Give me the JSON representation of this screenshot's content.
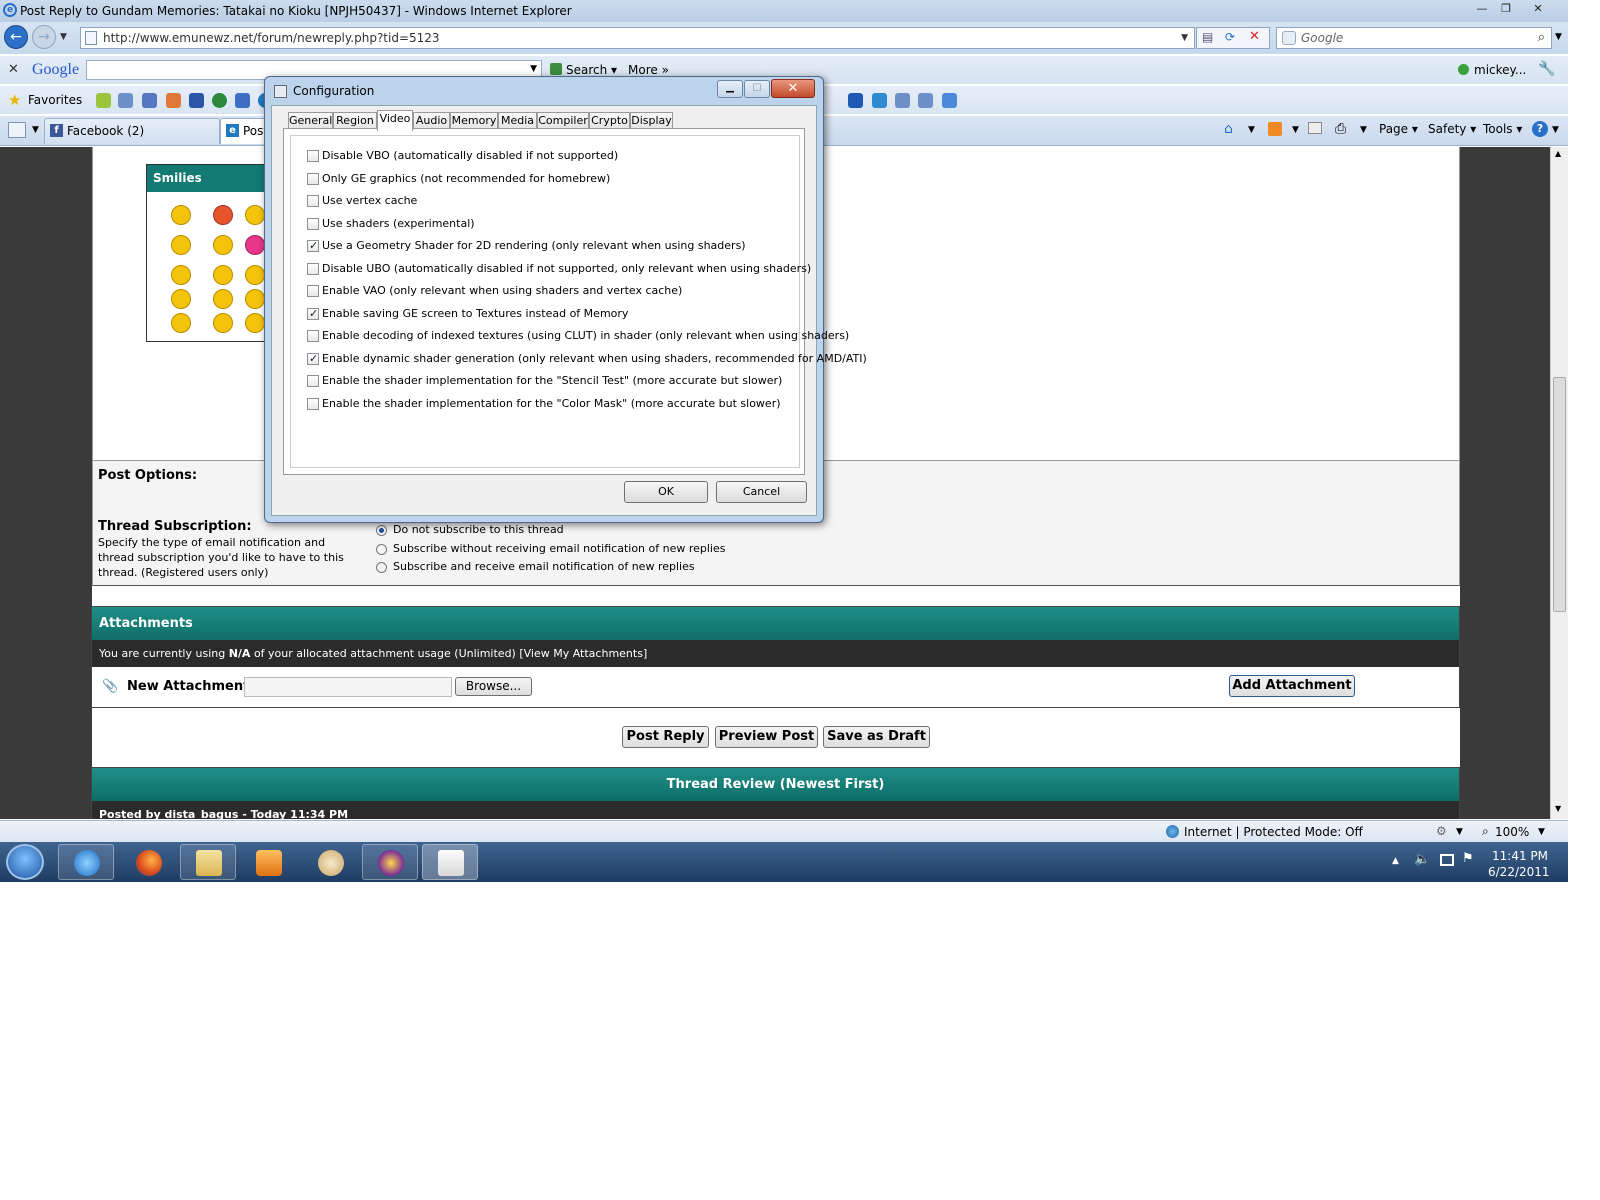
{
  "window": {
    "title": "Post Reply to Gundam Memories: Tatakai no Kioku [NPJH50437] - Windows Internet Explorer"
  },
  "address_bar": {
    "url": "http://www.emunewz.net/forum/newreply.php?tid=5123",
    "search_placeholder": "Google"
  },
  "google_toolbar": {
    "logo": "Google",
    "search_label": "Search",
    "more_label": "More",
    "user": "mickey..."
  },
  "favorites_bar": {
    "label": "Favorites"
  },
  "tabs": [
    {
      "label": "Facebook (2)"
    },
    {
      "label": "Post"
    }
  ],
  "command_bar": {
    "page": "Page",
    "safety": "Safety",
    "tools": "Tools"
  },
  "page": {
    "smilies_header": "Smilies",
    "post_options_label": "Post Options:",
    "thread_subscription": {
      "label": "Thread Subscription:",
      "description": "Specify the type of email notification and thread subscription you'd like to have to this thread. (Registered users only)",
      "options": [
        "Do not subscribe to this thread",
        "Subscribe without receiving email notification of new replies",
        "Subscribe and receive email notification of new replies"
      ]
    },
    "attachments": {
      "header": "Attachments",
      "usage_prefix": "You are currently using ",
      "usage_value": "N/A",
      "usage_suffix": " of your allocated attachment usage (Unlimited) [View My Attachments]",
      "new_attachment_label": "New Attachment:",
      "browse_button": "Browse...",
      "add_button": "Add Attachment"
    },
    "buttons": {
      "post_reply": "Post Reply",
      "preview_post": "Preview Post",
      "save_draft": "Save as Draft"
    },
    "thread_review": {
      "header": "Thread Review (Newest First)",
      "posted_by": "Posted by dista_bagus - Today 11:34 PM"
    }
  },
  "dialog": {
    "title": "Configuration",
    "tabs": [
      "General",
      "Region",
      "Video",
      "Audio",
      "Memory",
      "Media",
      "Compiler",
      "Crypto",
      "Display"
    ],
    "active_tab": "Video",
    "options": [
      {
        "label": "Disable VBO (automatically disabled if not supported)",
        "checked": false
      },
      {
        "label": "Only GE graphics (not recommended for homebrew)",
        "checked": false
      },
      {
        "label": "Use vertex cache",
        "checked": false
      },
      {
        "label": "Use shaders (experimental)",
        "checked": false
      },
      {
        "label": "Use a Geometry Shader for 2D rendering (only relevant when using shaders)",
        "checked": true
      },
      {
        "label": "Disable UBO (automatically disabled if not supported, only relevant when using shaders)",
        "checked": false
      },
      {
        "label": "Enable VAO (only relevant when using shaders and vertex cache)",
        "checked": false
      },
      {
        "label": "Enable saving GE screen to Textures instead of Memory",
        "checked": true
      },
      {
        "label": "Enable decoding of indexed textures (using CLUT) in shader (only relevant when using shaders)",
        "checked": false
      },
      {
        "label": "Enable dynamic shader generation (only relevant when using shaders, recommended for AMD/ATI)",
        "checked": true
      },
      {
        "label": "Enable the shader implementation for the \"Stencil Test\" (more accurate but slower)",
        "checked": false
      },
      {
        "label": "Enable the shader implementation for the \"Color Mask\" (more accurate but slower)",
        "checked": false
      }
    ],
    "ok": "OK",
    "cancel": "Cancel"
  },
  "status_bar": {
    "zone": "Internet | Protected Mode: Off",
    "zoom": "100%"
  },
  "taskbar": {
    "time": "11:41 PM",
    "date": "6/22/2011"
  }
}
